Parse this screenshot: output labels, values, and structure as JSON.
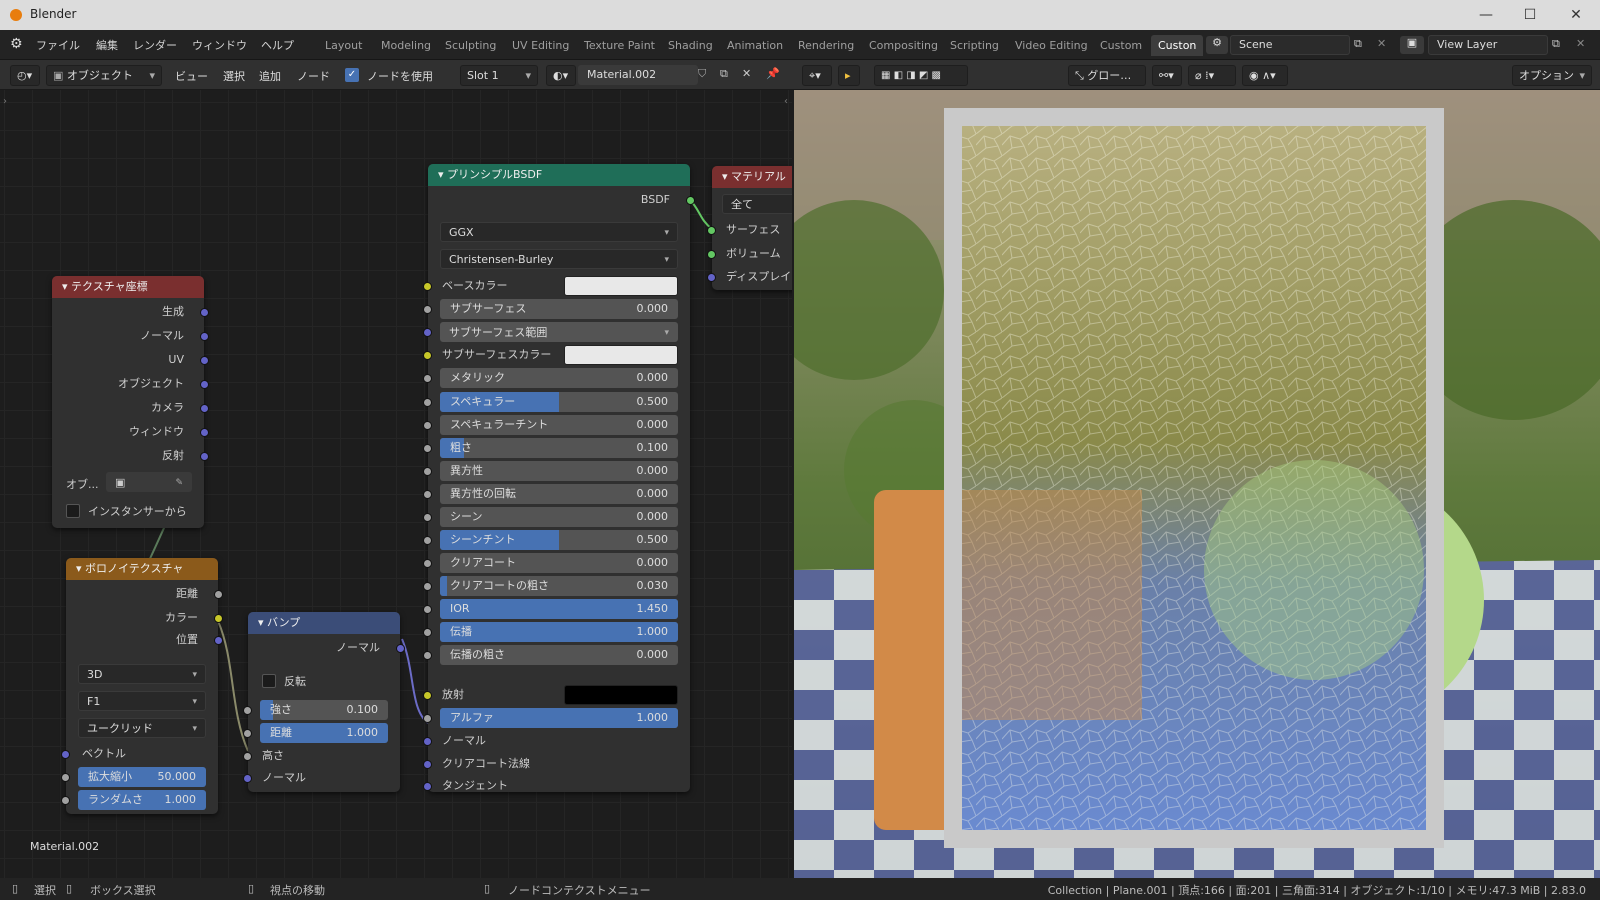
{
  "app": {
    "title": "Blender"
  },
  "menu": [
    "ファイル",
    "編集",
    "レンダー",
    "ウィンドウ",
    "ヘルプ"
  ],
  "workspaces": [
    "Layout",
    "Modeling",
    "Sculpting",
    "UV Editing",
    "Texture Paint",
    "Shading",
    "Animation",
    "Rendering",
    "Compositing",
    "Scripting",
    "Video Editing",
    "Custom",
    "Custon"
  ],
  "scene": {
    "name": "Scene",
    "view_layer": "View Layer"
  },
  "node_header": {
    "mode": "オブジェクト",
    "menus": [
      "ビュー",
      "選択",
      "追加",
      "ノード"
    ],
    "use_nodes_label": "ノードを使用",
    "slot": "Slot 1",
    "material": "Material.002"
  },
  "viewport_header": {
    "transform": "グロー…",
    "options": "オプション"
  },
  "nodes": {
    "texcoord": {
      "title": "テクスチャ座標",
      "outputs": [
        "生成",
        "ノーマル",
        "UV",
        "オブジェクト",
        "カメラ",
        "ウィンドウ",
        "反射"
      ],
      "object_label": "オブ...",
      "instancer_label": "インスタンサーから"
    },
    "voronoi": {
      "title": "ボロノイテクスチャ",
      "outputs": [
        "距離",
        "カラー",
        "位置"
      ],
      "dims": "3D",
      "feature": "F1",
      "metric": "ユークリッド",
      "vector_label": "ベクトル",
      "scale_label": "拡大縮小",
      "scale_value": "50.000",
      "random_label": "ランダムさ",
      "random_value": "1.000"
    },
    "bump": {
      "title": "バンプ",
      "output": "ノーマル",
      "invert_label": "反転",
      "strength_label": "強さ",
      "strength_value": "0.100",
      "distance_label": "距離",
      "distance_value": "1.000",
      "height_label": "高さ",
      "normal_label": "ノーマル"
    },
    "bsdf": {
      "title": "プリンシプルBSDF",
      "output": "BSDF",
      "distribution": "GGX",
      "subsurface_method": "Christensen-Burley",
      "base_color_label": "ベースカラー",
      "subsurface_radius": "サブサーフェス範囲",
      "subsurface_color_label": "サブサーフェスカラー",
      "emission_label": "放射",
      "fields": [
        {
          "label": "サブサーフェス",
          "value": "0.000",
          "fill": 0
        },
        {
          "label": "メタリック",
          "value": "0.000",
          "fill": 0
        },
        {
          "label": "スペキュラー",
          "value": "0.500",
          "fill": 0.5
        },
        {
          "label": "スペキュラーチント",
          "value": "0.000",
          "fill": 0
        },
        {
          "label": "粗さ",
          "value": "0.100",
          "fill": 0.1
        },
        {
          "label": "異方性",
          "value": "0.000",
          "fill": 0
        },
        {
          "label": "異方性の回転",
          "value": "0.000",
          "fill": 0
        },
        {
          "label": "シーン",
          "value": "0.000",
          "fill": 0
        },
        {
          "label": "シーンチント",
          "value": "0.500",
          "fill": 0.5
        },
        {
          "label": "クリアコート",
          "value": "0.000",
          "fill": 0
        },
        {
          "label": "クリアコートの粗さ",
          "value": "0.030",
          "fill": 0.03
        },
        {
          "label": "IOR",
          "value": "1.450",
          "fill": 1
        },
        {
          "label": "伝播",
          "value": "1.000",
          "fill": 1
        },
        {
          "label": "伝播の粗さ",
          "value": "0.000",
          "fill": 0
        },
        {
          "label": "アルファ",
          "value": "1.000",
          "fill": 1
        }
      ],
      "inputs_bottom": [
        "ノーマル",
        "クリアコート法線",
        "タンジェント"
      ]
    },
    "output": {
      "title": "マテリアル",
      "target": "全て",
      "inputs": [
        "サーフェス",
        "ボリューム",
        "ディスプレイ"
      ]
    }
  },
  "canvas_label": "Material.002",
  "status": {
    "select": "選択",
    "box_select": "ボックス選択",
    "view_move": "視点の移動",
    "context_menu": "ノードコンテクストメニュー",
    "stats": "Collection | Plane.001 | 頂点:166 | 面:201 | 三角面:314 | オブジェクト:1/10 | メモリ:47.3 MiB | 2.83.0"
  },
  "colors": {
    "accent": "#4772b3",
    "shader_header": "#1f6e58",
    "texture_header": "#8b5a1b",
    "vector_header": "#3b4d78"
  }
}
